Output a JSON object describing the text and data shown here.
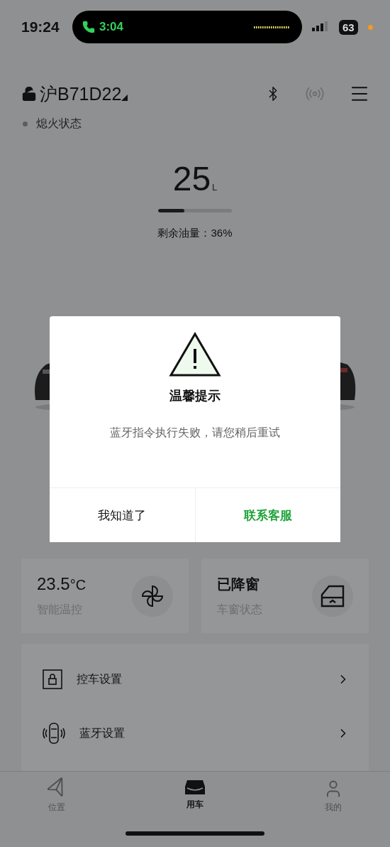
{
  "status_bar": {
    "time": "19:24",
    "call_time": "3:04",
    "battery": "63"
  },
  "header": {
    "plate": "沪B71D22",
    "engine_status": "熄火状态"
  },
  "fuel": {
    "amount": "25",
    "unit": "L",
    "level": 0.36,
    "label": "剩余油量：36%"
  },
  "dialog": {
    "title": "温馨提示",
    "message": "蓝牙指令执行失败，请您稍后重试",
    "buttons": [
      {
        "label": "我知道了",
        "kind": "secondary"
      },
      {
        "label": "联系客服",
        "kind": "primary"
      }
    ]
  },
  "cards": [
    {
      "kind": "fan",
      "value": "23.5",
      "unit": "°C",
      "label": "智能温控"
    },
    {
      "kind": "window",
      "value": "已降窗",
      "label": "车窗状态"
    }
  ],
  "settings": [
    {
      "kind": "lock",
      "label": "控车设置"
    },
    {
      "kind": "bluetooth",
      "label": "蓝牙设置"
    }
  ],
  "tabs": [
    {
      "kind": "location",
      "label": "位置",
      "selected": false
    },
    {
      "kind": "car",
      "label": "用车",
      "selected": true
    },
    {
      "kind": "profile",
      "label": "我的",
      "selected": false
    }
  ]
}
